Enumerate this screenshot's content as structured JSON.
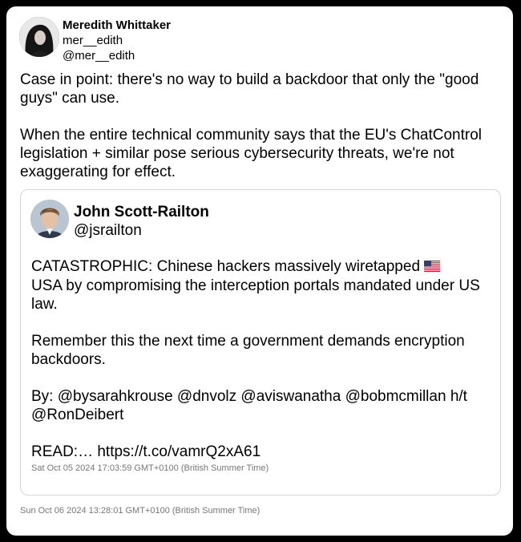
{
  "tweet": {
    "author_name": "Meredith Whittaker",
    "author_display": "mer__edith",
    "author_handle": "@mer__edith",
    "text": "Case in point: there's no way to build a backdoor that only the \"good guys\" can use.\n\nWhen the entire technical community says that the EU's ChatControl legislation + similar pose serious cybersecurity threats, we're not exaggerating for effect.",
    "timestamp": "Sun Oct 06 2024 13:28:01 GMT+0100 (British Summer Time)"
  },
  "quoted": {
    "author_name": "John Scott-Railton",
    "author_handle": "@jsrailton",
    "text_before_flag": "CATASTROPHIC: Chinese hackers massively wiretapped ",
    "flag_icon": "us-flag-icon",
    "text_after_flag": "\nUSA by compromising the interception portals mandated under US law.\n\nRemember this the next time a government demands encryption backdoors.\n\nBy: @bysarahkrouse @dnvolz @aviswanatha @bobmcmillan h/t @RonDeibert\n\nREAD:… https://t.co/vamrQ2xA61",
    "timestamp": "Sat Oct 05 2024 17:03:59 GMT+0100 (British Summer Time)"
  }
}
